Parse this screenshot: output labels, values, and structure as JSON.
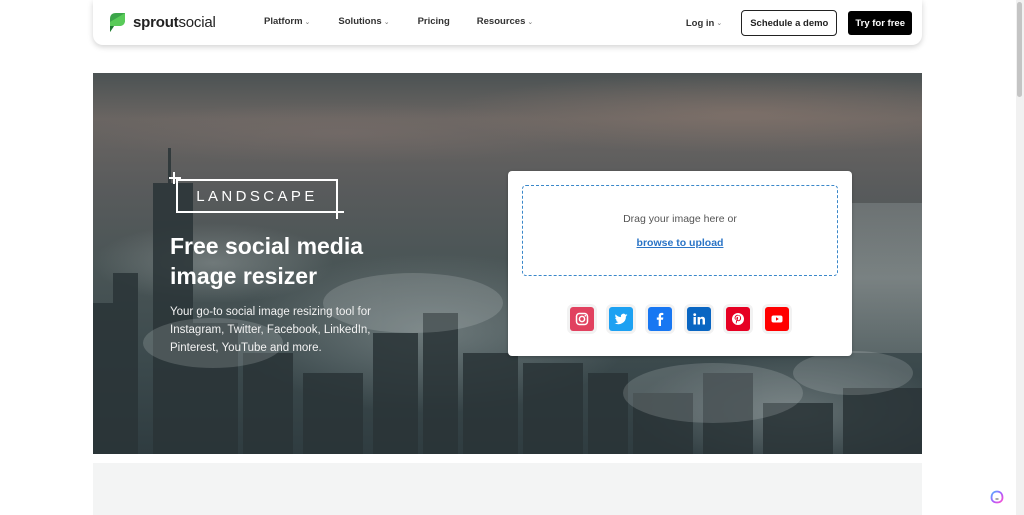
{
  "brand": {
    "name_bold": "sprout",
    "name_light": "social",
    "logo_icon": "sprout-leaf-icon",
    "color": "#3ca54a"
  },
  "nav": {
    "links": [
      {
        "label": "Platform",
        "has_dropdown": true
      },
      {
        "label": "Solutions",
        "has_dropdown": true
      },
      {
        "label": "Pricing",
        "has_dropdown": false
      },
      {
        "label": "Resources",
        "has_dropdown": true
      }
    ],
    "login_label": "Log in",
    "schedule_demo_label": "Schedule a demo",
    "try_free_label": "Try for free"
  },
  "hero": {
    "badge": "LANDSCAPE",
    "title_line1": "Free social media",
    "title_line2": "image resizer",
    "subtitle_line1": "Your go-to social image resizing tool for",
    "subtitle_line2": "Instagram, Twitter, Facebook, LinkedIn,",
    "subtitle_line3": "Pinterest, YouTube and more."
  },
  "upload": {
    "drag_text": "Drag your image here or",
    "browse_link": "browse to upload",
    "accent_color": "#2a74c6",
    "networks": [
      {
        "name": "instagram",
        "icon": "instagram-icon",
        "color": "#e1415f"
      },
      {
        "name": "twitter",
        "icon": "twitter-icon",
        "color": "#1da1f2"
      },
      {
        "name": "facebook",
        "icon": "facebook-icon",
        "color": "#1877f2"
      },
      {
        "name": "linkedin",
        "icon": "linkedin-icon",
        "color": "#0a66c2"
      },
      {
        "name": "pinterest",
        "icon": "pinterest-icon",
        "color": "#e60023"
      },
      {
        "name": "youtube",
        "icon": "youtube-icon",
        "color": "#ff0000"
      }
    ]
  },
  "widgets": {
    "chat_icon": "chat-assistant-icon"
  }
}
